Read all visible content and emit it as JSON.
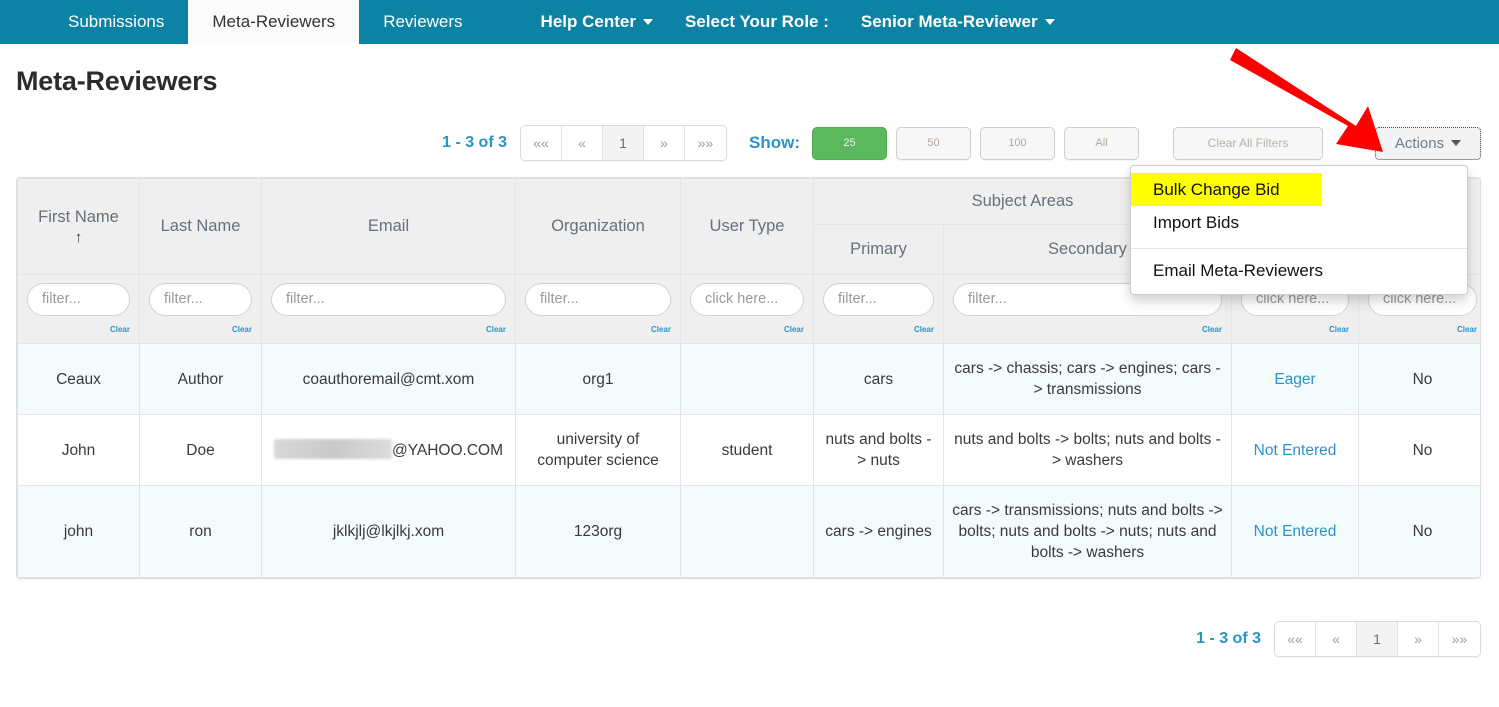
{
  "navbar": {
    "tabs": [
      {
        "label": "Submissions",
        "active": false
      },
      {
        "label": "Meta-Reviewers",
        "active": true
      },
      {
        "label": "Reviewers",
        "active": false
      }
    ],
    "help_center": "Help Center",
    "select_role_label": "Select Your Role :",
    "current_role": "Senior Meta-Reviewer",
    "brand_color": "#0c82a4"
  },
  "page": {
    "title": "Meta-Reviewers"
  },
  "toolbar": {
    "count": "1 - 3 of 3",
    "pager": [
      "««",
      "«",
      "1",
      "»",
      "»»"
    ],
    "pager_current": "1",
    "show_label": "Show:",
    "page_sizes": [
      "25",
      "50",
      "100",
      "All"
    ],
    "page_size_selected": "25",
    "clear_all_filters": "Clear All Filters",
    "actions_label": "Actions",
    "accent_color": "#2a93c9",
    "active_size_color": "#5cb85c"
  },
  "actions_menu": {
    "items": [
      {
        "label": "Bulk Change Bid",
        "highlighted": true
      },
      {
        "label": "Import Bids",
        "highlighted": false
      },
      {
        "label": "Email Meta-Reviewers",
        "highlighted": false
      }
    ],
    "highlight_color": "#ffff00"
  },
  "table": {
    "group_header": "Subject Areas",
    "headers": {
      "first_name": "First Name",
      "last_name": "Last Name",
      "email": "Email",
      "organization": "Organization",
      "user_type": "User Type",
      "primary": "Primary",
      "secondary": "Secondary",
      "bid_status": "",
      "last_col": "?"
    },
    "sort_indicator": "↑",
    "filters": {
      "first_name": "filter...",
      "last_name": "filter...",
      "email": "filter...",
      "organization": "filter...",
      "user_type": "click here...",
      "primary": "filter...",
      "secondary": "filter...",
      "bid_status": "click here...",
      "last_col": "click here..."
    },
    "clear_label": "Clear",
    "rows": [
      {
        "first_name": "Ceaux",
        "last_name": "Author",
        "email": "coauthoremail@cmt.xom",
        "email_redacted": false,
        "organization": "org1",
        "user_type": "",
        "primary": "cars",
        "secondary": "cars -> chassis; cars -> engines; cars -> transmissions",
        "bid_status": "Eager",
        "last_col": "No"
      },
      {
        "first_name": "John",
        "last_name": "Doe",
        "email": "@YAHOO.COM",
        "email_redacted": true,
        "organization": "university of computer science",
        "user_type": "student",
        "primary": "nuts and bolts -> nuts",
        "secondary": "nuts and bolts -> bolts; nuts and bolts -> washers",
        "bid_status": "Not Entered",
        "last_col": "No"
      },
      {
        "first_name": "john",
        "last_name": "ron",
        "email": "jklkjlj@lkjlkj.xom",
        "email_redacted": false,
        "organization": "123org",
        "user_type": "",
        "primary": "cars -> engines",
        "secondary": "cars -> transmissions; nuts and bolts -> bolts; nuts and bolts -> nuts; nuts and bolts -> washers",
        "bid_status": "Not Entered",
        "last_col": "No"
      }
    ]
  },
  "bottom": {
    "count": "1 - 3 of 3",
    "pager": [
      "««",
      "«",
      "1",
      "»",
      "»»"
    ],
    "pager_current": "1"
  },
  "annotation": {
    "arrow_color": "#ff0000"
  }
}
